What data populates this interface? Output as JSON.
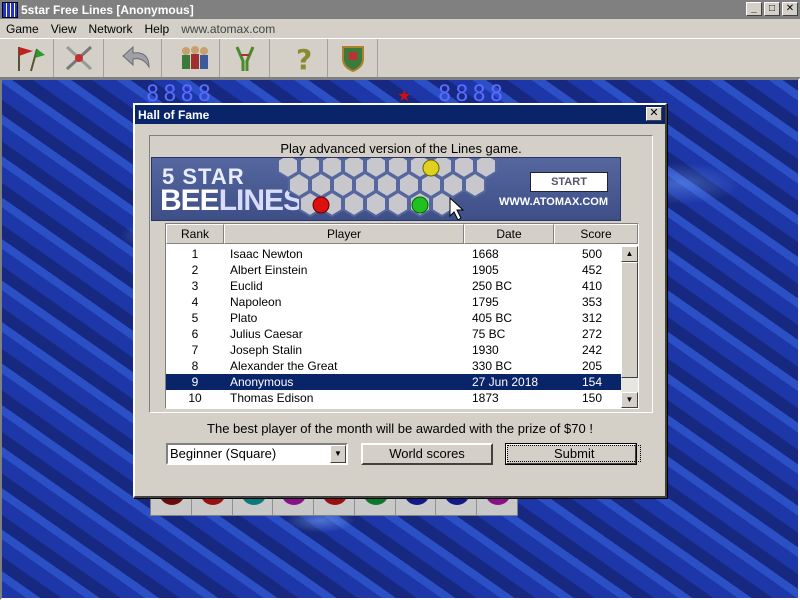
{
  "window": {
    "title": "5star Free Lines [Anonymous]",
    "minimize": "_",
    "maximize": "□",
    "close": "✕"
  },
  "menu": {
    "items": [
      "Game",
      "View",
      "Network",
      "Help"
    ],
    "link": "www.atomax.com"
  },
  "toolbar": {
    "icons": [
      "flags-icon",
      "broken-tools-icon",
      "undo-icon",
      "players-icon",
      "tuning-fork-icon",
      "help-question-icon",
      "hall-of-fame-shield-icon"
    ]
  },
  "board": {
    "score_left": "8888",
    "score_right": "8888"
  },
  "dialog": {
    "title": "Hall of Fame",
    "close": "✕",
    "promo": "Play advanced version of the Lines game.",
    "banner": {
      "line1": "5 STAR",
      "line2a": "BEE",
      "line2b": "LINES",
      "url": "WWW.ATOMAX.COM",
      "start": "START"
    },
    "columns": [
      "Rank",
      "Player",
      "Date",
      "Score"
    ],
    "rows": [
      {
        "rank": "1",
        "player": "Isaac Newton",
        "date": "1668",
        "score": "500"
      },
      {
        "rank": "2",
        "player": "Albert Einstein",
        "date": "1905",
        "score": "452"
      },
      {
        "rank": "3",
        "player": "Euclid",
        "date": "250 BC",
        "score": "410"
      },
      {
        "rank": "4",
        "player": "Napoleon",
        "date": "1795",
        "score": "353"
      },
      {
        "rank": "5",
        "player": "Plato",
        "date": "405 BC",
        "score": "312"
      },
      {
        "rank": "6",
        "player": "Julius Caesar",
        "date": "75 BC",
        "score": "272"
      },
      {
        "rank": "7",
        "player": "Joseph Stalin",
        "date": "1930",
        "score": "242"
      },
      {
        "rank": "8",
        "player": "Alexander the Great",
        "date": "330 BC",
        "score": "205"
      },
      {
        "rank": "9",
        "player": "Anonymous",
        "date": "27 Jun 2018",
        "score": "154",
        "selected": true
      },
      {
        "rank": "10",
        "player": "Thomas Edison",
        "date": "1873",
        "score": "150"
      }
    ],
    "prize_text": "The best player of the month will be awarded with the prize of $70 !",
    "level_select": "Beginner (Square)",
    "world_scores": "World scores",
    "submit": "Submit"
  },
  "colors": {
    "selection": "#0a246a",
    "dialog_bg": "#d4d0c8",
    "water": "#1a30a0"
  }
}
